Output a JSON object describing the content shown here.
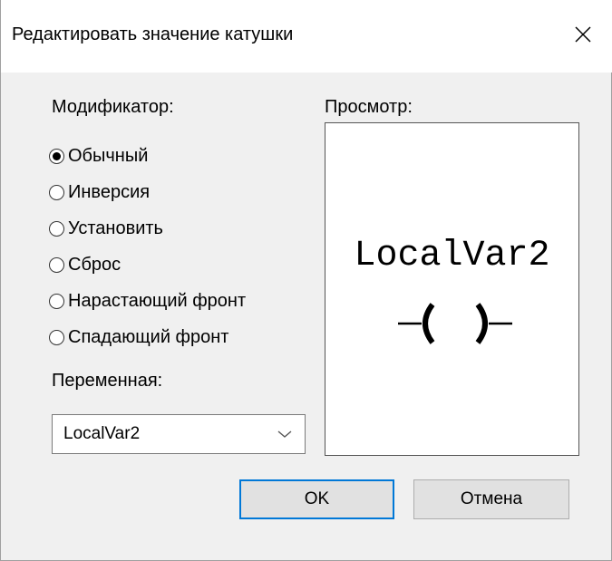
{
  "window": {
    "title": "Редактировать значение катушки",
    "close_icon": "close-icon"
  },
  "modifier": {
    "label": "Модификатор:",
    "selected": "Обычный",
    "options": [
      "Обычный",
      "Инверсия",
      "Установить",
      "Сброс",
      "Нарастающий фронт",
      "Спадающий фронт"
    ]
  },
  "variable": {
    "label": "Переменная:",
    "value": "LocalVar2",
    "dropdown_icon": "chevron-down-icon"
  },
  "preview": {
    "label": "Просмотр:",
    "variable_name": "LocalVar2",
    "symbol": "coil-symbol"
  },
  "buttons": {
    "ok_label": "OK",
    "cancel_label": "Отмена"
  },
  "colors": {
    "focus_border": "#0078d7",
    "dialog_bg": "#f0f0f0",
    "button_bg": "#e1e1e1"
  }
}
